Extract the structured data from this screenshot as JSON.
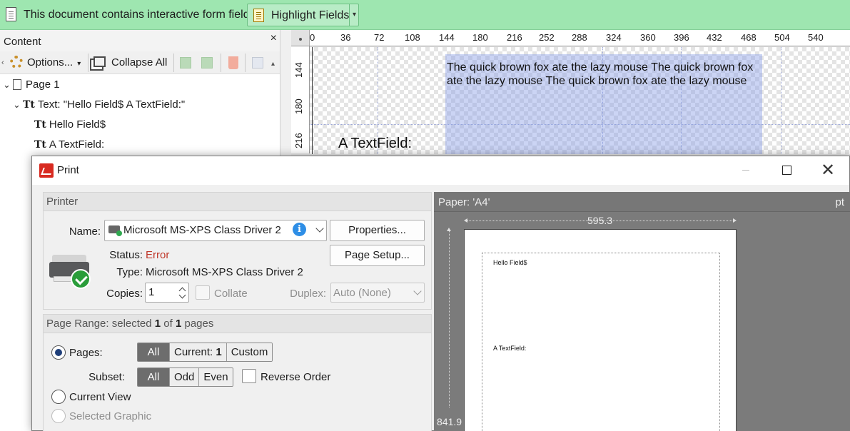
{
  "notice": {
    "message": "This document contains interactive form fields.",
    "button_label": "Highlight Fields"
  },
  "content_panel": {
    "title": "Content",
    "close_glyph": "×",
    "toolbar": {
      "options_label": "Options...",
      "collapse_label": "Collapse All"
    },
    "tree": [
      {
        "label": "Page 1"
      },
      {
        "label": "Text: \"Hello Field$ A TextField:\""
      },
      {
        "label": "Hello Field$"
      },
      {
        "label": "A TextField:"
      }
    ],
    "text_glyph": "Tt"
  },
  "document": {
    "ruler_h_labels": [
      "0",
      "36",
      "72",
      "108",
      "144",
      "180",
      "216",
      "252",
      "288",
      "324",
      "360",
      "396",
      "432",
      "468",
      "504",
      "540"
    ],
    "ruler_v_labels": [
      "144",
      "180",
      "216"
    ],
    "field_text": "The quick brown fox ate the lazy mouse The quick brown fox ate the lazy mouse The quick brown fox ate the lazy mouse",
    "textfield_label": "A TextField:"
  },
  "print_dialog": {
    "title": "Print",
    "printer_group": "Printer",
    "name_label": "Name:",
    "printer_name": "Microsoft MS-XPS Class Driver 2",
    "properties_button": "Properties...",
    "page_setup_button": "Page Setup...",
    "status_label": "Status:",
    "status_value": "Error",
    "status_color": "#c0392b",
    "type_label": "Type:",
    "type_value": "Microsoft MS-XPS Class Driver 2",
    "copies_label": "Copies:",
    "copies_value": "1",
    "collate_label": "Collate",
    "duplex_label": "Duplex:",
    "duplex_value": "Auto (None)",
    "page_range": {
      "prefix": "Page Range: selected ",
      "selected": "1",
      "middle": " of ",
      "total": "1",
      "suffix": " pages"
    },
    "pages_label": "Pages:",
    "pages_options": {
      "all": "All",
      "current_prefix": "Current: ",
      "current_value": "1",
      "custom": "Custom"
    },
    "subset_label": "Subset:",
    "subset_options": {
      "all": "All",
      "odd": "Odd",
      "even": "Even"
    },
    "reverse_order_label": "Reverse Order",
    "current_view_label": "Current View",
    "selected_graphic_label": "Selected Graphic",
    "preview": {
      "paper_label": "Paper: 'A4'",
      "unit": "pt",
      "width": "595.3",
      "height": "841.9",
      "line1": "Hello Field$",
      "line2": "A TextField:"
    }
  },
  "colors": {
    "notice_bar": "#9ee6b0",
    "field_highlight": "#8ca0e6",
    "selected_segment": "#6d6d6d",
    "preview_bg": "#7b7b7b"
  }
}
